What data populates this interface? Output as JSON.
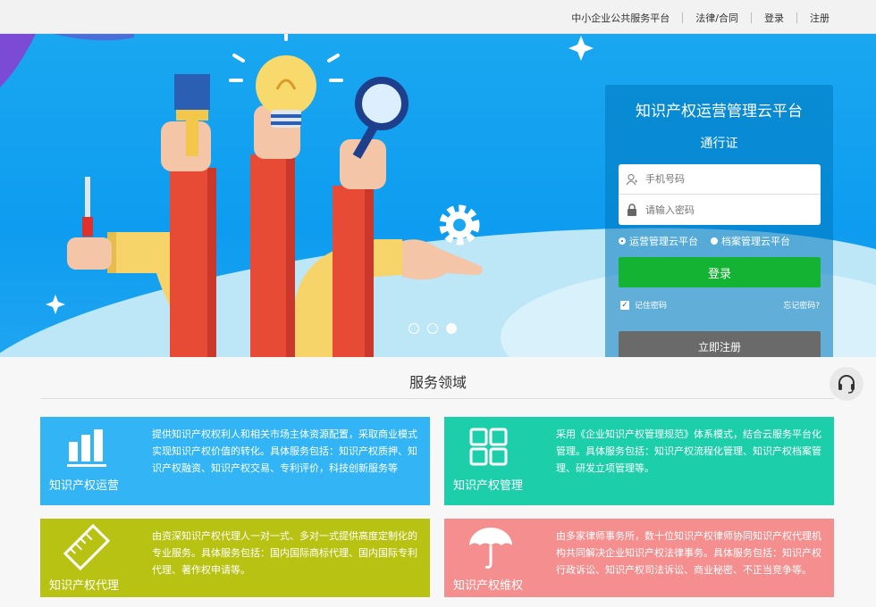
{
  "topbar": {
    "links": [
      "中小企业公共服务平台",
      "法律/合同",
      "登录",
      "注册"
    ]
  },
  "login": {
    "title": "知识产权运营管理云平台",
    "subtitle": "通行证",
    "phone_placeholder": "手机号码",
    "password_placeholder": "请输入密码",
    "radio_options": [
      "运营管理云平台",
      "档案管理云平台"
    ],
    "selected_option": "运营管理云平台",
    "login_button": "登录",
    "remember_label": "记住密码",
    "remember_checked": true,
    "forgot_link": "忘记密码?",
    "register_button": "立即注册"
  },
  "carousel": {
    "slide_count": 3,
    "active_slide": 3
  },
  "services": {
    "title": "服务领域",
    "cards": [
      {
        "title": "知识产权运营",
        "icon": "bar-chart-icon",
        "color": "#33b5f5",
        "description": "提供知识产权权利人和相关市场主体资源配置，采取商业模式实现知识产权价值的转化。具体服务包括：知识产权质押、知识产权融资、知识产权交易、专利评价，科技创新服务等"
      },
      {
        "title": "知识产权管理",
        "icon": "grid-icon",
        "color": "#1ccfaa",
        "description": "采用《企业知识产权管理规范》体系模式，结合云服务平台化管理。具体服务包括：知识产权流程化管理、知识产权档案管理、研发立项管理等。"
      },
      {
        "title": "知识产权代理",
        "icon": "ruler-icon",
        "color": "#b8c212",
        "description": "由资深知识产权代理人一对一式、多对一式提供高度定制化的专业服务。具体服务包括：国内国际商标代理、国内国际专利代理、著作权申请等。"
      },
      {
        "title": "知识产权维权",
        "icon": "umbrella-icon",
        "color": "#f58e8e",
        "description": "由多家律师事务所，数十位知识产权律师协同知识产权代理机构共同解决企业知识产权法律事务。具体服务包括：知识产权行政诉讼、知识产权司法诉讼、商业秘密、不正当竞争等。"
      }
    ]
  }
}
